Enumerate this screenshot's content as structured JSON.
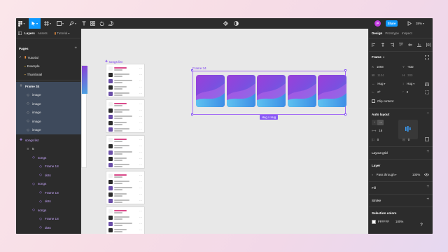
{
  "toolbar": {
    "share_label": "Share",
    "avatar_initial": "P",
    "zoom_label": "38%"
  },
  "left_panel": {
    "tabs": [
      "Layers",
      "Assets"
    ],
    "page_switcher": "Tutorial",
    "pages_title": "Pages",
    "pages": [
      {
        "label": "Tutorial",
        "checked": true,
        "emoji": "📘"
      },
      {
        "label": "Example",
        "emoji": "💡"
      },
      {
        "label": "Thumbnail",
        "emoji": "🖼"
      }
    ],
    "layers": [
      {
        "label": "Frame 34",
        "indent": 0,
        "selected": true,
        "icon": "frame-icon"
      },
      {
        "label": "image",
        "indent": 1,
        "selected": true,
        "icon": "image-icon"
      },
      {
        "label": "image",
        "indent": 1,
        "selected": true,
        "icon": "image-icon"
      },
      {
        "label": "image",
        "indent": 1,
        "selected": true,
        "icon": "image-icon"
      },
      {
        "label": "image",
        "indent": 1,
        "selected": true,
        "icon": "image-icon"
      },
      {
        "label": "image",
        "indent": 1,
        "selected": true,
        "icon": "image-icon"
      },
      {
        "label": "songs list",
        "indent": 0,
        "selected": false,
        "icon": "component-icon"
      },
      {
        "label": "5",
        "indent": 1,
        "selected": false,
        "icon": "autolayout-icon"
      },
      {
        "label": "songs",
        "indent": 2,
        "selected": false,
        "icon": "instance-icon"
      },
      {
        "label": "Frame 18",
        "indent": 3,
        "selected": false,
        "icon": "instance-icon"
      },
      {
        "label": "dots",
        "indent": 3,
        "selected": false,
        "icon": "instance-icon"
      },
      {
        "label": "songs",
        "indent": 2,
        "selected": false,
        "icon": "instance-icon"
      },
      {
        "label": "Frame 18",
        "indent": 3,
        "selected": false,
        "icon": "instance-icon"
      },
      {
        "label": "dots",
        "indent": 3,
        "selected": false,
        "icon": "instance-icon"
      },
      {
        "label": "songs",
        "indent": 2,
        "selected": false,
        "icon": "instance-icon"
      },
      {
        "label": "Frame 18",
        "indent": 3,
        "selected": false,
        "icon": "instance-icon"
      },
      {
        "label": "dots",
        "indent": 3,
        "selected": false,
        "icon": "instance-icon"
      }
    ]
  },
  "canvas": {
    "songs_list_label": "songs list",
    "frame_label": "Frame 34",
    "hug_badge": "Hug × Hug",
    "tile_count": 5
  },
  "right_panel": {
    "tabs": [
      "Design",
      "Prototype",
      "Inspect"
    ],
    "frame_section": "Frame",
    "x": "1093",
    "y": "-932",
    "w": "1104",
    "h": "300",
    "w_mode": "Hug",
    "h_mode": "Hug",
    "rotation": "0°",
    "radius": "0",
    "clip_content": "Clip content",
    "auto_layout_title": "Auto layout",
    "gap": "16",
    "padding_h": "0",
    "padding_v": "0",
    "layout_grid_title": "Layout grid",
    "layer_title": "Layer",
    "blend_mode": "Pass through",
    "layer_opacity": "100%",
    "fill_title": "Fill",
    "stroke_title": "Stroke",
    "selection_colors_title": "Selection colors",
    "selection_color_hex": "FFFFFF",
    "selection_color_opacity": "100%"
  },
  "colors": {
    "accent": "#0d99ff",
    "selection": "#8a5cf5",
    "panel_bg": "#2c2c2c",
    "canvas_bg": "#e8e8e8"
  },
  "help_label": "?"
}
